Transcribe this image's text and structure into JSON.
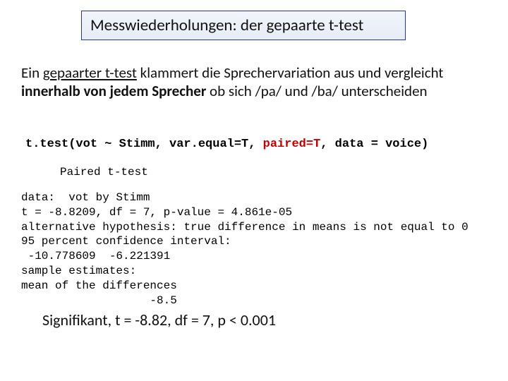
{
  "title": "Messwiederholungen: der gepaarte t-test",
  "body": {
    "seg1": "Ein ",
    "seg2_u": "gepaarter t-test",
    "seg3": " klammert die Sprechervariation aus und vergleicht ",
    "seg4_b": "innerhalb von jedem Sprecher",
    "seg5": " ob sich  /pa/ und  /ba/ unterscheiden"
  },
  "code": {
    "pre": "t.test(vot ~ Stimm, var.equal=T, ",
    "paired": "paired=T",
    "post": ", data = voice)"
  },
  "output_title": "Paired t-test",
  "output": "data:  vot by Stimm\nt = -8.8209, df = 7, p-value = 4.861e-05\nalternative hypothesis: true difference in means is not equal to 0\n95 percent confidence interval:\n -10.778609  -6.221391\nsample estimates:\nmean of the differences\n                   -8.5",
  "conclusion": "Signifikant, t = -8.82, df = 7, p < 0.001"
}
